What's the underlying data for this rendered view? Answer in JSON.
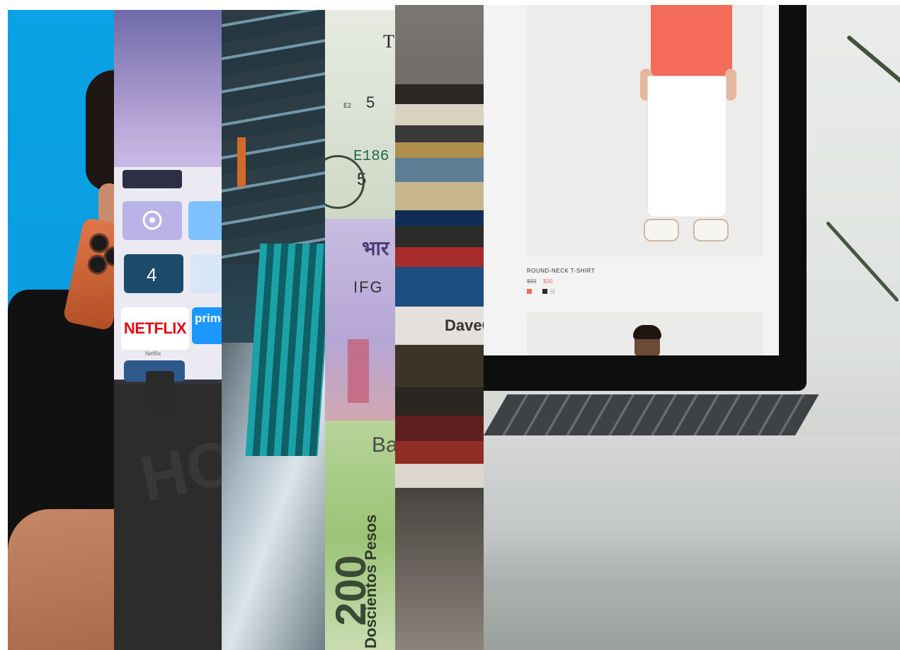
{
  "collage": {
    "strips": [
      {
        "subject": "person holding phone",
        "bg_color": "#0aa3e6"
      },
      {
        "subject": "tv streaming apps"
      },
      {
        "subject": "subway train platform"
      },
      {
        "subject": "banknotes"
      },
      {
        "subject": "stacked books"
      },
      {
        "subject": "laptop showing shop"
      }
    ]
  },
  "tv_apps": {
    "netflix_label": "NETFLIX",
    "netflix_sub": "Netflix",
    "prime_label": "prime",
    "cabinet_text": "HO"
  },
  "banknotes": {
    "usd_letter": "T",
    "usd_five": "5",
    "usd_small": "E2",
    "usd_serial": "E186",
    "usd_five_bottom": "5",
    "inr_text": "भार",
    "inr_serial": "IFG",
    "mxn_text": "Ba",
    "mxn_value": "200",
    "mxn_words": "Doscientos Pesos"
  },
  "books": {
    "spine_text": "DaveG"
  },
  "laptop_shop": {
    "product_name": "ROUND-NECK T-SHIRT",
    "price_old": "$59",
    "price_new": "$30",
    "swatch_colors": [
      "#f06b5e",
      "#2b2b2b",
      "#d9d9d9"
    ]
  }
}
